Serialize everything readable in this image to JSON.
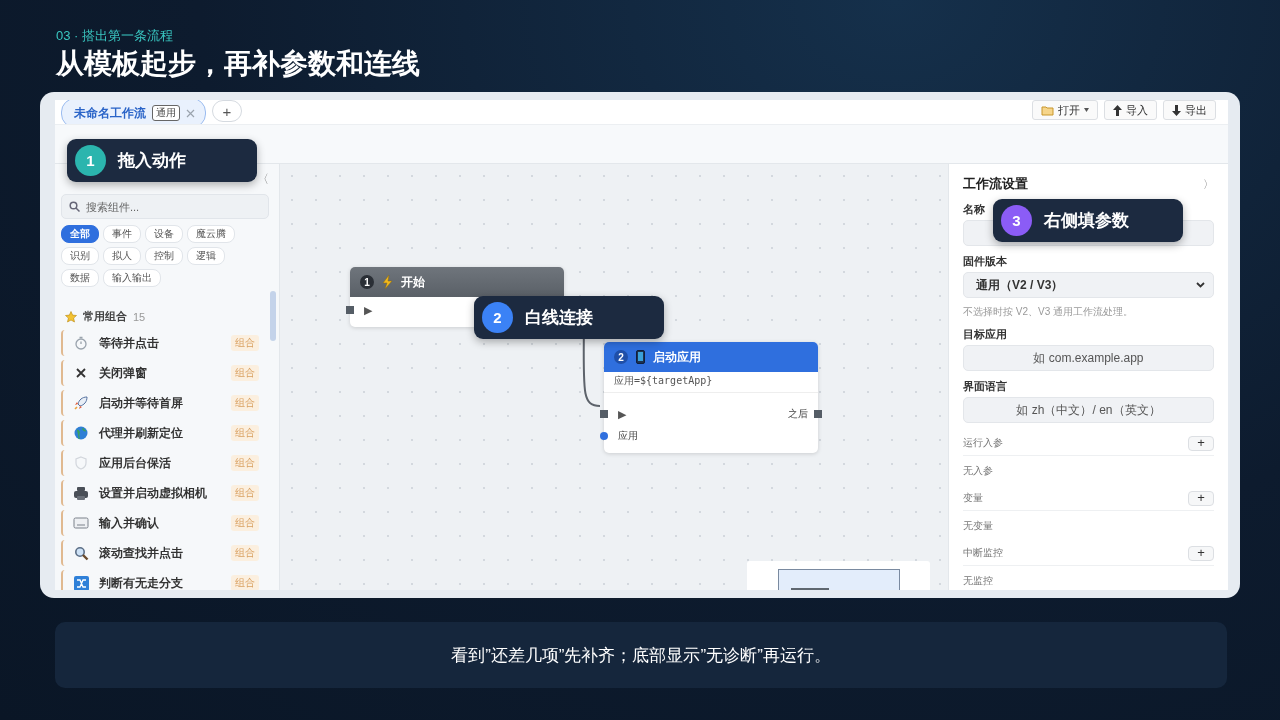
{
  "slide": {
    "section": "03 · 搭出第一条流程",
    "title": "从模板起步，再补参数和连线",
    "caption": "看到”还差几项”先补齐；底部显示”无诊断”再运行。"
  },
  "app": {
    "tabs": [
      {
        "label": "未命名工作流",
        "badge": "通用",
        "selected": true
      }
    ],
    "add_tab": "+",
    "toolbar": [
      {
        "kind": "open",
        "label": "打开"
      },
      {
        "kind": "import",
        "label": "导入"
      },
      {
        "kind": "export",
        "label": "导出"
      }
    ],
    "sidebar": {
      "collapse": "〈",
      "search": {
        "placeholder": "搜索组件..."
      },
      "filters": [
        {
          "label": "全部",
          "selected": true
        },
        {
          "label": "事件",
          "selected": false
        },
        {
          "label": "设备",
          "selected": false
        },
        {
          "label": "魔云腾",
          "selected": false
        },
        {
          "label": "识别",
          "selected": false
        },
        {
          "label": "拟人",
          "selected": false
        },
        {
          "label": "控制",
          "selected": false
        },
        {
          "label": "逻辑",
          "selected": false
        },
        {
          "label": "数据",
          "selected": false
        },
        {
          "label": "输入输出",
          "selected": false
        }
      ],
      "section": {
        "title": "常用组合",
        "count": "15"
      },
      "items": [
        {
          "kind": "stopwatch",
          "label": "等待并点击",
          "tag": "组合"
        },
        {
          "kind": "cross",
          "label": "关闭弹窗",
          "tag": "组合"
        },
        {
          "kind": "rocket",
          "label": "启动并等待首屏",
          "tag": "组合"
        },
        {
          "kind": "globe",
          "label": "代理并刷新定位",
          "tag": "组合"
        },
        {
          "kind": "shield",
          "label": "应用后台保活",
          "tag": "组合"
        },
        {
          "kind": "camera",
          "label": "设置并启动虚拟相机",
          "tag": "组合"
        },
        {
          "kind": "keyboard",
          "label": "输入并确认",
          "tag": "组合"
        },
        {
          "kind": "magnifier",
          "label": "滚动查找并点击",
          "tag": "组合"
        },
        {
          "kind": "branch",
          "label": "判断有无走分支",
          "tag": "组合"
        }
      ]
    },
    "canvas": {
      "nodes": [
        {
          "kind": "start",
          "number": "1",
          "title": "开始",
          "run": "▶"
        },
        {
          "kind": "action",
          "number": "2",
          "title": "启动应用",
          "param": "应用=${targetApp}",
          "run": "▶",
          "output": "之后",
          "input": "应用"
        }
      ]
    },
    "settings": {
      "title": "工作流设置",
      "collapse": "〉",
      "name": {
        "label": "名称"
      },
      "firmware": {
        "label": "固件版本",
        "value": "通用（V2 / V3）",
        "hint": "不选择时按 V2、V3 通用工作流处理。"
      },
      "target_app": {
        "label": "目标应用",
        "placeholder": "如 com.example.app"
      },
      "language": {
        "label": "界面语言",
        "placeholder": "如 zh（中文）/ en（英文）"
      },
      "sections": [
        {
          "title": "运行入参",
          "add": "+",
          "empty": "无入参"
        },
        {
          "title": "变量",
          "add": "+",
          "empty": "无变量"
        },
        {
          "title": "中断监控",
          "add": "+",
          "empty": "无监控"
        }
      ]
    }
  },
  "callouts": [
    {
      "number": "1",
      "text": "拖入动作",
      "color": "#2bb5ae"
    },
    {
      "number": "2",
      "text": "白线连接",
      "color": "#3b82f6"
    },
    {
      "number": "3",
      "text": "右侧填参数",
      "color": "#8b5cf6"
    }
  ]
}
